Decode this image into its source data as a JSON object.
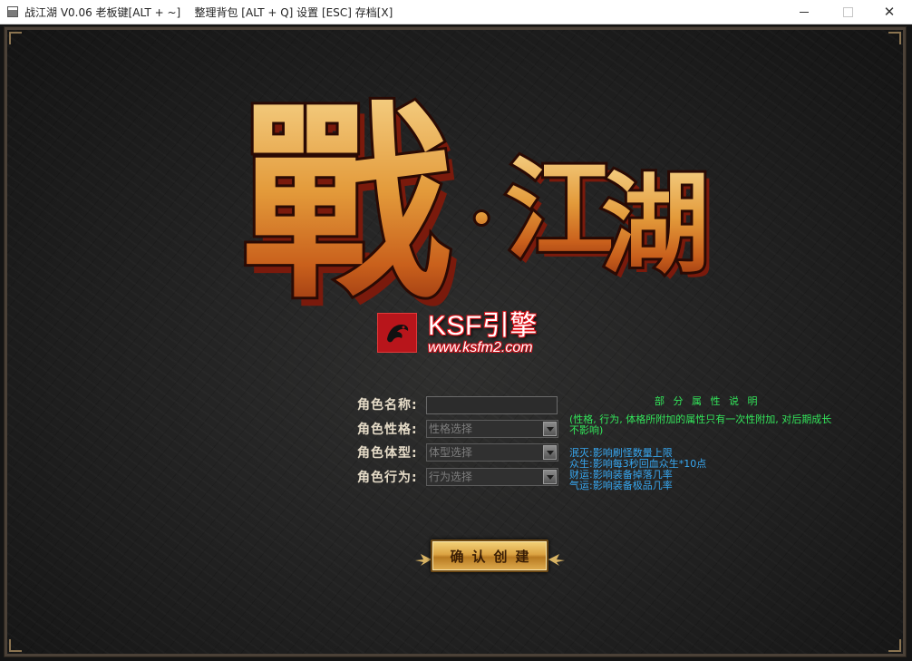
{
  "window": {
    "title": "战江湖 V0.06 老板键[ALT + ~]    整理背包 [ALT + Q] 设置 [ESC] 存档[X]",
    "minimize": "minimize",
    "maximize": "maximize",
    "close": "✕"
  },
  "logo": {
    "char1": "戰",
    "char2": "江",
    "char3": "湖",
    "dot": "·"
  },
  "engine": {
    "name": "KSF引擎",
    "url": "www.ksfm2.com"
  },
  "form": {
    "name_label": "角色名称:",
    "name_value": "",
    "personality_label": "角色性格:",
    "personality_placeholder": "性格选择",
    "body_label": "角色体型:",
    "body_placeholder": "体型选择",
    "behavior_label": "角色行为:",
    "behavior_placeholder": "行为选择"
  },
  "notes": {
    "title": "部 分 属 性 说 明",
    "intro": "(性格, 行为, 体格所附加的属性只有一次性附加, 对后期成长不影响)",
    "items": [
      "泯灭:影响刷怪数量上限",
      "众生:影响每3秒回血众生*10点",
      "财运:影响装备掉落几率",
      "气运:影响装备极品几率"
    ]
  },
  "confirm": {
    "label": "确认创建"
  },
  "colors": {
    "accent_green": "#33e55a",
    "accent_blue": "#37a8f2",
    "gold": "#dca443"
  }
}
